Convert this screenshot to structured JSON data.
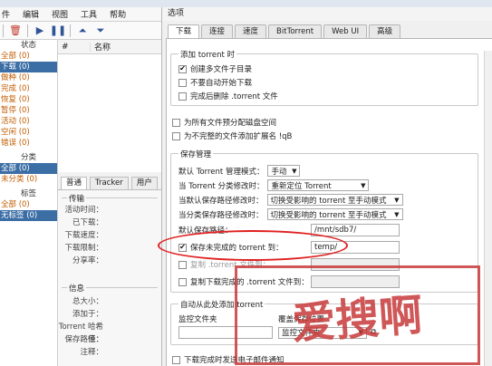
{
  "app": {
    "menu": [
      "件",
      "编辑",
      "视图",
      "工具",
      "帮助"
    ],
    "toolbar_icons": [
      "delete-icon",
      "play-icon",
      "pause-icon",
      "move-up-icon",
      "move-down-icon"
    ]
  },
  "sidebar": {
    "status_header": "状态",
    "status_items": [
      {
        "label": "全部 (0)",
        "selected": false
      },
      {
        "label": "下载 (0)",
        "selected": true
      },
      {
        "label": "做种 (0)",
        "selected": false
      },
      {
        "label": "完成 (0)",
        "selected": false
      },
      {
        "label": "恢复 (0)",
        "selected": false
      },
      {
        "label": "暂停 (0)",
        "selected": false
      },
      {
        "label": "活动 (0)",
        "selected": false
      },
      {
        "label": "空闲 (0)",
        "selected": false
      },
      {
        "label": "错误 (0)",
        "selected": false
      }
    ],
    "category_header": "分类",
    "category_items": [
      {
        "label": "全部 (0)",
        "selected": true
      },
      {
        "label": "未分类 (0)",
        "selected": false
      }
    ],
    "tag_header": "标签",
    "tag_items": [
      {
        "label": "全部 (0)",
        "selected": false
      },
      {
        "label": "无标签 (0)",
        "selected": true
      }
    ]
  },
  "list": {
    "col_num": "#",
    "col_name": "名称"
  },
  "details": {
    "tabs": [
      "普通",
      "Tracker",
      "用户"
    ],
    "transfer_title": "传输",
    "transfer_fields": [
      "活动时间：",
      "已下载：",
      "下载速度：",
      "下载限制：",
      "分享率："
    ],
    "info_title": "信息",
    "info_fields": [
      "总大小：",
      "添加于：",
      "Torrent 哈希值：",
      "保存路径：",
      "注释："
    ]
  },
  "dialog": {
    "title": "选项",
    "tabs": [
      "下载",
      "连接",
      "速度",
      "BitTorrent",
      "Web UI",
      "高级"
    ],
    "active_tab": "下载",
    "add_group": {
      "legend": "添加 torrent 时",
      "opt1": "创建多文件子目录",
      "opt2": "不要自动开始下载",
      "opt3": "完成后删除 .torrent 文件"
    },
    "prealloc": "为所有文件预分配磁盘空间",
    "append_ext": "为不完整的文件添加扩展名 !qB",
    "save_mgmt": {
      "legend": "保存管理",
      "mode_label": "默认 Torrent 管理模式：",
      "mode_value": "手动",
      "cat_changed_label": "当 Torrent 分类修改时：",
      "cat_changed_value": "重新定位 Torrent",
      "default_path_changed_label": "当默认保存路径修改时：",
      "default_path_changed_value": "切换受影响的 torrent 至手动模式",
      "cat_path_changed_label": "当分类保存路径修改时：",
      "cat_path_changed_value": "切换受影响的 torrent 至手动模式",
      "default_save_label": "默认保存路径：",
      "default_save_value": "/mnt/sdb7/",
      "incomplete_label": "保存未完成的 torrent 到：",
      "incomplete_value": "temp/",
      "copy_label": "复制 .torrent 文件到：",
      "copy_finished_label": "复制下载完成的 .torrent 文件到："
    },
    "auto_add": {
      "legend": "自动从此处添加 torrent",
      "col_watch": "监控文件夹",
      "col_save": "覆盖保存位置",
      "save_value": "监控文件夹"
    },
    "email": "下载完成时发送电子邮件通知"
  },
  "watermark": "爱搜啊"
}
